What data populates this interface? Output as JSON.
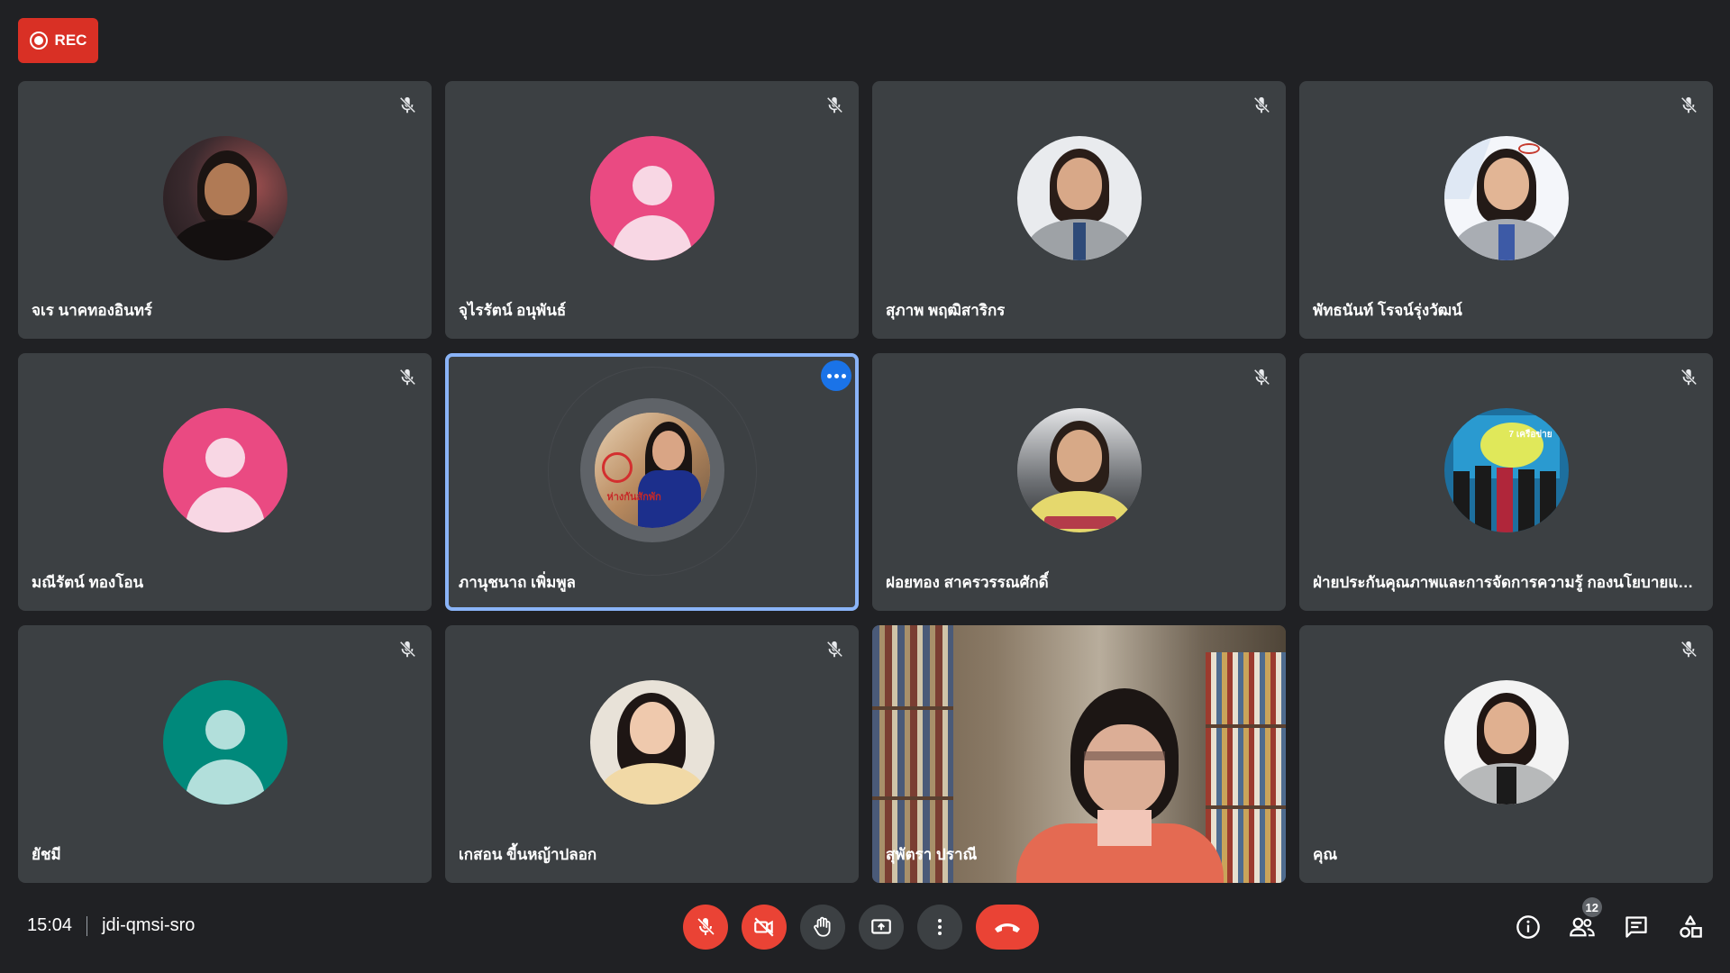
{
  "rec": {
    "label": "REC"
  },
  "participants": [
    {
      "name": "จเร นาคทองอินทร์",
      "muted": true,
      "avatar": "photo"
    },
    {
      "name": "จุไรรัตน์ อนุพันธ์",
      "muted": true,
      "avatar": "default"
    },
    {
      "name": "สุภาพ พฤฒิสาริกร",
      "muted": true,
      "avatar": "photo"
    },
    {
      "name": "พัทธนันท์ โรจน์รุ่งวัฒน์",
      "muted": true,
      "avatar": "photo"
    },
    {
      "name": "มณีรัตน์ ทองโอน",
      "muted": true,
      "avatar": "default"
    },
    {
      "name": "ภานุชนาถ เพิ่มพูล",
      "muted": false,
      "avatar": "photo",
      "speaking": true,
      "sign_text": "ห่างกันสักพัก"
    },
    {
      "name": "ฝอยทอง สาครวรรณศักดิ์",
      "muted": true,
      "avatar": "photo"
    },
    {
      "name": "ฝ่ายประกันคุณภาพและการจัดการความรู้ กองนโยบายแล...",
      "muted": true,
      "avatar": "photo",
      "poster_text": "7 เครือข่าย"
    },
    {
      "name": "ยัชมี",
      "muted": true,
      "avatar": "default"
    },
    {
      "name": "เกสอน ขี้นหญ้าปลอก",
      "muted": true,
      "avatar": "photo"
    },
    {
      "name": "สุพัตรา ปราณี",
      "muted": false,
      "avatar": "video"
    },
    {
      "name": "คุณ",
      "muted": true,
      "avatar": "photo"
    }
  ],
  "bottom_bar": {
    "time": "15:04",
    "meeting_code": "jdi-qmsi-sro",
    "participant_count": "12"
  },
  "controls": {
    "mic": "mic-off-icon",
    "camera": "camera-off-icon",
    "hand": "raise-hand-icon",
    "present": "present-screen-icon",
    "more": "more-options-icon",
    "leave": "end-call-icon"
  },
  "colors": {
    "background": "#202124",
    "tile": "#3c4043",
    "danger": "#ea4335",
    "rec": "#d93025",
    "active_outline": "#8ab4f8",
    "avatar_pink": "#ea4a82",
    "avatar_pink_light": "#f8bbd0",
    "avatar_teal": "#00897b",
    "avatar_teal_light": "#b2dfdb"
  }
}
